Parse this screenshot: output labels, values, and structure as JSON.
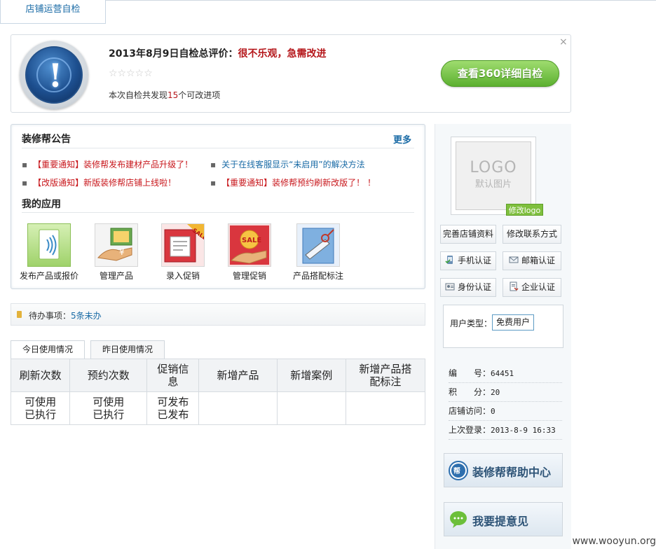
{
  "top_tab": {
    "label": "店铺运营自检"
  },
  "self_check": {
    "title_prefix": "2013年8月9日自检总评价：",
    "rating": "很不乐观，急需改进",
    "stars": "☆☆☆☆☆",
    "stars_value": 0,
    "stars_max": 5,
    "found_prefix": "本次自检共发现",
    "found_count": "15",
    "found_suffix": "个可改进项",
    "detail_button": "查看360详细自检",
    "close_glyph": "×"
  },
  "announcements": {
    "title": "装修帮公告",
    "more": "更多",
    "items": [
      {
        "text": "【重要通知】装修帮发布建材产品升级了！",
        "color": "#c8171c"
      },
      {
        "text": "关于在线客服显示“未启用”的解决方法",
        "color": "#1a6ba6"
      },
      {
        "text": "【改版通知】新版装修帮店铺上线啦！",
        "color": "#c8171c"
      },
      {
        "text": "【重要通知】装修帮预约刷新改版了！ ！",
        "color": "#c8171c"
      }
    ]
  },
  "apps": {
    "title": "我的应用",
    "items": [
      {
        "label": "发布产品或报价",
        "icon": "publish-product-icon"
      },
      {
        "label": "管理产品",
        "icon": "manage-product-icon"
      },
      {
        "label": "录入促销",
        "icon": "sale-entry-icon"
      },
      {
        "label": "管理促销",
        "icon": "manage-sale-icon"
      },
      {
        "label": "产品搭配标注",
        "icon": "product-match-icon"
      }
    ]
  },
  "todo": {
    "label": "待办事项：",
    "value": "5条未办"
  },
  "usage": {
    "tabs": [
      "今日使用情况",
      "昨日使用情况"
    ],
    "headers": [
      "刷新次数",
      "预约次数",
      "促销信息",
      "新增产品",
      "新增案例",
      "新增产品搭配标注"
    ],
    "row": [
      [
        "可使用",
        "已执行"
      ],
      [
        "可使用",
        "已执行"
      ],
      [
        "可发布",
        "已发布"
      ],
      [
        ""
      ],
      [
        ""
      ],
      [
        ""
      ]
    ]
  },
  "sidebar": {
    "logo_big": "LOGO",
    "logo_small": "默认图片",
    "edit_logo": "修改logo",
    "buttons": [
      "完善店铺资料",
      "修改联系方式",
      "手机认证",
      "邮箱认证",
      "身份认证",
      "企业认证"
    ],
    "user_type_label": "用户类型：",
    "user_type_value": "免费用户",
    "info": [
      {
        "key": "编　　号：",
        "value": "64451"
      },
      {
        "key": "积　　分：",
        "value": "20"
      },
      {
        "key": "店铺访问：",
        "value": "0"
      },
      {
        "key": "上次登录：",
        "value": "2013-8-9 16:33"
      }
    ],
    "help_center": "装修帮帮助中心",
    "feedback": "我要提意见"
  },
  "watermark": "www.wooyun.org"
}
